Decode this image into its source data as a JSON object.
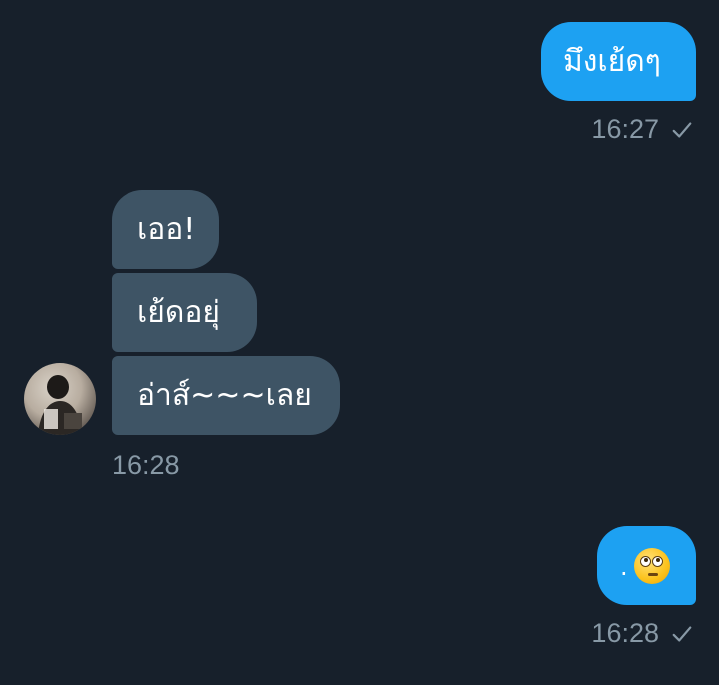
{
  "conversation": {
    "messages": [
      {
        "direction": "outgoing",
        "text": "มึงเย้ดๆ",
        "time": "16:27",
        "status_icon": "checkmark-icon"
      },
      {
        "direction": "incoming",
        "bubbles": [
          "เออ!",
          "เย้ดอยุ่",
          "อ่าส์~~~เลย"
        ],
        "time": "16:28",
        "avatar_icon": "user-avatar"
      },
      {
        "direction": "outgoing",
        "text": ".",
        "emoji": "face-with-rolling-eyes-icon",
        "time": "16:28",
        "status_icon": "checkmark-icon"
      }
    ]
  },
  "colors": {
    "background": "#17202b",
    "outgoing_bubble": "#1da1f2",
    "incoming_bubble": "#3e5465",
    "timestamp": "#8899a6"
  }
}
